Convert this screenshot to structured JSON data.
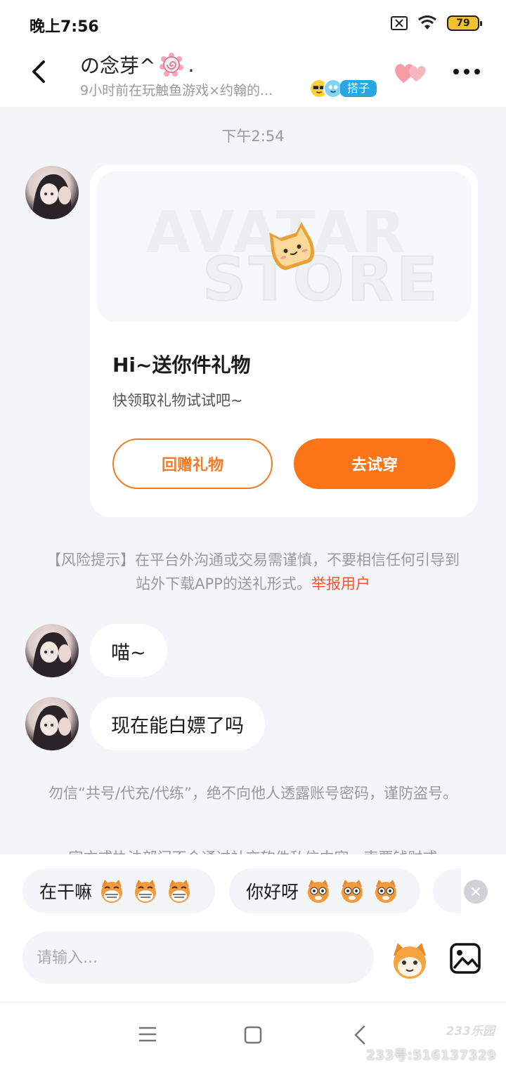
{
  "status_bar": {
    "time": "晚上7:56",
    "battery": "79"
  },
  "header": {
    "name": "の念芽^",
    "name_suffix": ".",
    "subtitle": "9小时前在玩触鱼游戏×约翰的...",
    "tag": "搭子"
  },
  "chat": {
    "timestamp": "下午2:54",
    "gift_card": {
      "watermark_line1": "AVATAR",
      "watermark_line2": "STORE",
      "title": "Hi~送你件礼物",
      "subtitle": "快领取礼物试试吧~",
      "return_button": "回赠礼物",
      "try_button": "去试穿"
    },
    "risk_notice": {
      "text": "【风险提示】在平台外沟通或交易需谨慎，不要相信任何引导到站外下载APP的送礼形式。",
      "link": "举报用户"
    },
    "messages": [
      {
        "text": "喵~"
      },
      {
        "text": "现在能白嫖了吗"
      }
    ],
    "warning": "勿信“共号/代充/代练”，绝不向他人透露账号密码，谨防盗号。",
    "warning_partial": "官方或执法部门不会通过社交软件私信内容，索要钱财或"
  },
  "quick_replies": [
    {
      "label": "在干嘛"
    },
    {
      "label": "你好呀"
    }
  ],
  "input": {
    "placeholder": "请输入..."
  },
  "watermark": {
    "logo": "233乐园",
    "id": "233号:516137329"
  },
  "colors": {
    "accent": "#fb7418",
    "link": "#f0552b",
    "tag": "#2aa7e0"
  }
}
